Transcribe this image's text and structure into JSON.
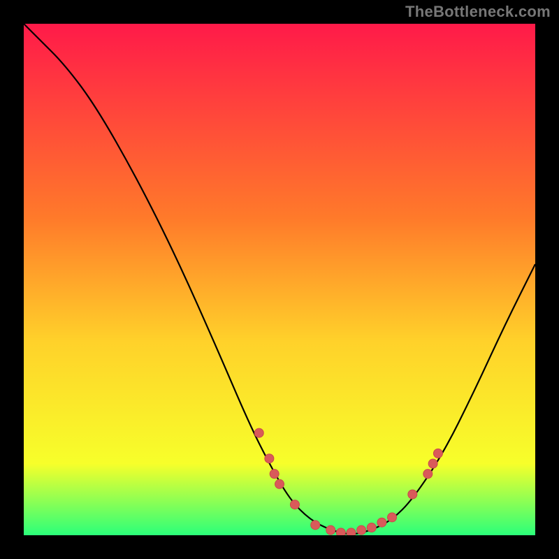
{
  "watermark": "TheBottleneck.com",
  "colors": {
    "background": "#000000",
    "grad_top": "#ff1a49",
    "grad_mid1": "#ff7a2a",
    "grad_mid2": "#ffd12a",
    "grad_mid3": "#f7ff2a",
    "grad_bottom": "#2bff7a",
    "curve": "#000000",
    "dot_fill": "#d95a5a",
    "dot_stroke": "#c94a4a"
  },
  "chart_data": {
    "type": "line",
    "title": "",
    "xlabel": "",
    "ylabel": "",
    "xlim": [
      0,
      100
    ],
    "ylim": [
      0,
      100
    ],
    "curve": [
      {
        "x": 0,
        "y": 100
      },
      {
        "x": 3,
        "y": 97
      },
      {
        "x": 8,
        "y": 92
      },
      {
        "x": 14,
        "y": 84
      },
      {
        "x": 22,
        "y": 70
      },
      {
        "x": 30,
        "y": 54
      },
      {
        "x": 38,
        "y": 36
      },
      {
        "x": 44,
        "y": 22
      },
      {
        "x": 48,
        "y": 14
      },
      {
        "x": 52,
        "y": 7
      },
      {
        "x": 56,
        "y": 3
      },
      {
        "x": 60,
        "y": 1
      },
      {
        "x": 64,
        "y": 0
      },
      {
        "x": 68,
        "y": 1
      },
      {
        "x": 72,
        "y": 3
      },
      {
        "x": 76,
        "y": 7
      },
      {
        "x": 82,
        "y": 16
      },
      {
        "x": 88,
        "y": 28
      },
      {
        "x": 94,
        "y": 41
      },
      {
        "x": 100,
        "y": 53
      }
    ],
    "dots": [
      {
        "x": 46,
        "y": 20
      },
      {
        "x": 48,
        "y": 15
      },
      {
        "x": 49,
        "y": 12
      },
      {
        "x": 50,
        "y": 10
      },
      {
        "x": 53,
        "y": 6
      },
      {
        "x": 57,
        "y": 2
      },
      {
        "x": 60,
        "y": 1
      },
      {
        "x": 62,
        "y": 0.5
      },
      {
        "x": 64,
        "y": 0.5
      },
      {
        "x": 66,
        "y": 1
      },
      {
        "x": 68,
        "y": 1.5
      },
      {
        "x": 70,
        "y": 2.5
      },
      {
        "x": 72,
        "y": 3.5
      },
      {
        "x": 76,
        "y": 8
      },
      {
        "x": 79,
        "y": 12
      },
      {
        "x": 80,
        "y": 14
      },
      {
        "x": 81,
        "y": 16
      }
    ]
  }
}
